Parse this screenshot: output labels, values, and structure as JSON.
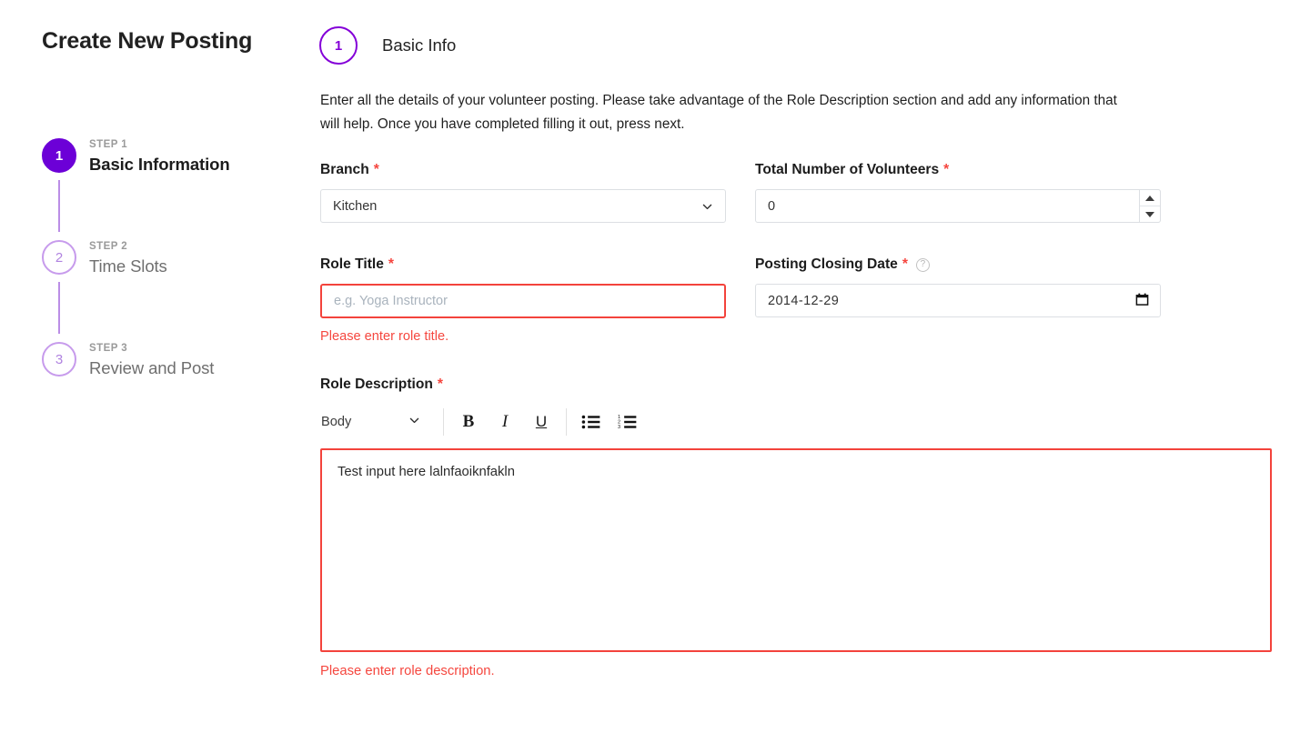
{
  "page": {
    "title": "Create New Posting"
  },
  "stepper": {
    "steps": [
      {
        "number": "1",
        "kicker": "STEP 1",
        "name": "Basic Information",
        "state": "active"
      },
      {
        "number": "2",
        "kicker": "STEP 2",
        "name": "Time Slots",
        "state": "inactive"
      },
      {
        "number": "3",
        "kicker": "STEP 3",
        "name": "Review and Post",
        "state": "inactive"
      }
    ]
  },
  "section": {
    "badge_number": "1",
    "heading": "Basic Info",
    "intro": "Enter all the details of your volunteer posting. Please take advantage of the Role Description section and add any information that will help. Once you have completed filling it out, press next."
  },
  "form": {
    "branch": {
      "label": "Branch",
      "required_mark": "*",
      "value": "Kitchen"
    },
    "total_volunteers": {
      "label": "Total Number of Volunteers",
      "required_mark": "*",
      "value": "0"
    },
    "role_title": {
      "label": "Role Title",
      "required_mark": "*",
      "value": "",
      "placeholder": "e.g. Yoga Instructor",
      "error": "Please enter role title."
    },
    "closing_date": {
      "label": "Posting Closing Date",
      "required_mark": "*",
      "help_glyph": "?",
      "value": "2014-12-29"
    },
    "role_description": {
      "label": "Role Description",
      "required_mark": "*",
      "toolbar": {
        "style_value": "Body",
        "bold_label": "B",
        "italic_label": "I",
        "underline_label": "U"
      },
      "value": "Test input here lalnfaoiknfakln",
      "error": "Please enter role description."
    }
  },
  "colors": {
    "accent": "#6c00d7",
    "accent_outline": "#8400d8",
    "step_inactive": "#c79bec",
    "error": "#f3433c",
    "border": "#dcdfe3"
  }
}
